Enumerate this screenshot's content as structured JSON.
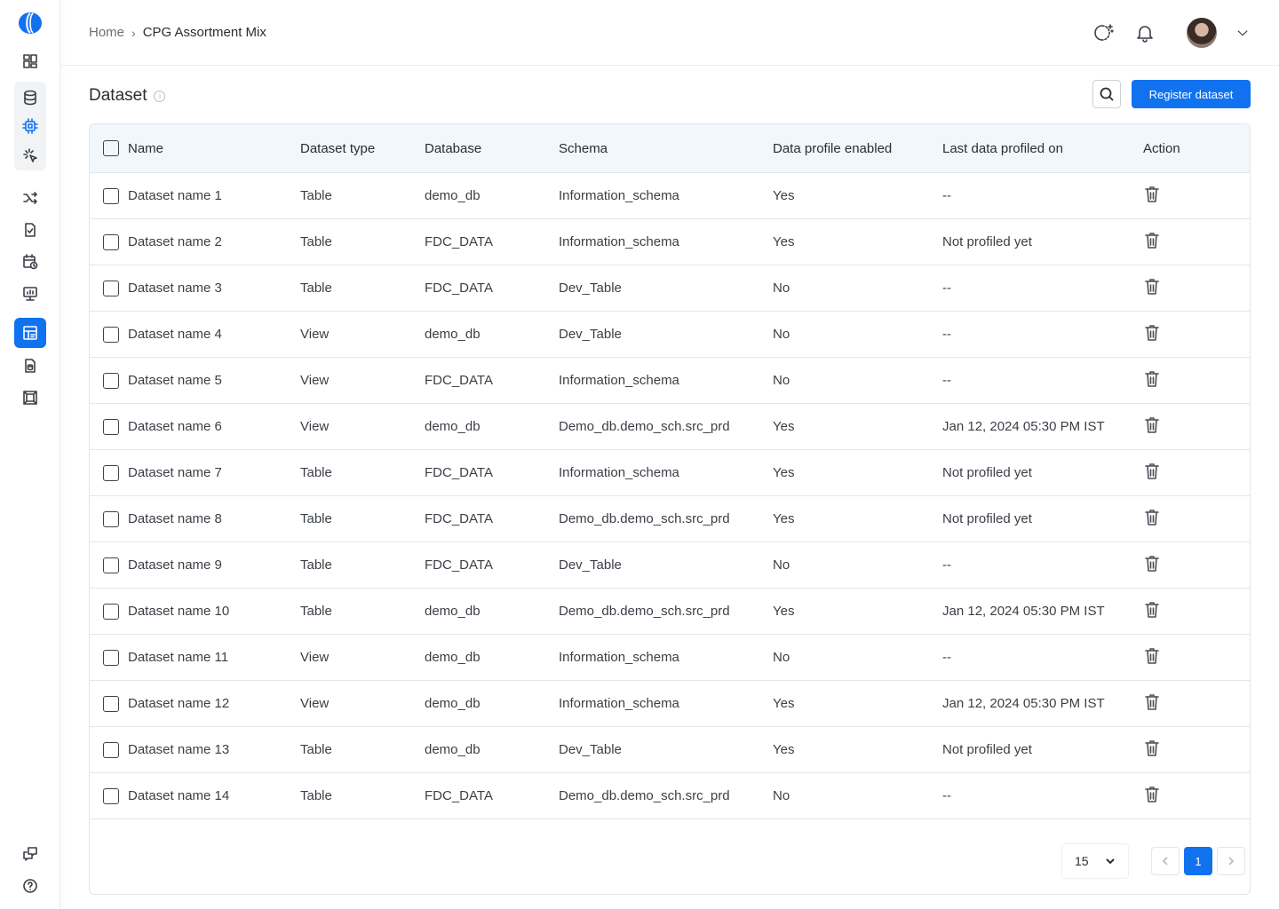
{
  "breadcrumb": {
    "home": "Home",
    "current": "CPG Assortment Mix"
  },
  "page": {
    "title": "Dataset",
    "info_glyph": "i"
  },
  "actions": {
    "register_label": "Register dataset"
  },
  "table": {
    "headers": {
      "name": "Name",
      "type": "Dataset type",
      "database": "Database",
      "schema": "Schema",
      "profile": "Data profile enabled",
      "last": "Last data profiled on",
      "action": "Action"
    },
    "rows": [
      {
        "name": "Dataset name 1",
        "type": "Table",
        "database": "demo_db",
        "schema": "Information_schema",
        "profile": "Yes",
        "last": "--"
      },
      {
        "name": "Dataset name 2",
        "type": "Table",
        "database": "FDC_DATA",
        "schema": "Information_schema",
        "profile": "Yes",
        "last": "Not profiled yet"
      },
      {
        "name": "Dataset name 3",
        "type": "Table",
        "database": "FDC_DATA",
        "schema": "Dev_Table",
        "profile": "No",
        "last": "--"
      },
      {
        "name": "Dataset name 4",
        "type": "View",
        "database": "demo_db",
        "schema": "Dev_Table",
        "profile": "No",
        "last": "--"
      },
      {
        "name": "Dataset name 5",
        "type": "View",
        "database": "FDC_DATA",
        "schema": "Information_schema",
        "profile": "No",
        "last": "--"
      },
      {
        "name": "Dataset name 6",
        "type": "View",
        "database": "demo_db",
        "schema": "Demo_db.demo_sch.src_prd",
        "profile": "Yes",
        "last": "Jan 12, 2024 05:30 PM IST"
      },
      {
        "name": "Dataset name 7",
        "type": "Table",
        "database": "FDC_DATA",
        "schema": "Information_schema",
        "profile": "Yes",
        "last": "Not profiled yet"
      },
      {
        "name": "Dataset name 8",
        "type": "Table",
        "database": "FDC_DATA",
        "schema": "Demo_db.demo_sch.src_prd",
        "profile": "Yes",
        "last": "Not profiled yet"
      },
      {
        "name": "Dataset name 9",
        "type": "Table",
        "database": "FDC_DATA",
        "schema": "Dev_Table",
        "profile": "No",
        "last": "--"
      },
      {
        "name": "Dataset name 10",
        "type": "Table",
        "database": "demo_db",
        "schema": "Demo_db.demo_sch.src_prd",
        "profile": "Yes",
        "last": "Jan 12, 2024 05:30 PM IST"
      },
      {
        "name": "Dataset name 11",
        "type": "View",
        "database": "demo_db",
        "schema": "Information_schema",
        "profile": "No",
        "last": "--"
      },
      {
        "name": "Dataset name 12",
        "type": "View",
        "database": "demo_db",
        "schema": "Information_schema",
        "profile": "Yes",
        "last": "Jan 12, 2024 05:30 PM IST"
      },
      {
        "name": "Dataset name 13",
        "type": "Table",
        "database": "demo_db",
        "schema": "Dev_Table",
        "profile": "Yes",
        "last": "Not profiled yet"
      },
      {
        "name": "Dataset name 14",
        "type": "Table",
        "database": "FDC_DATA",
        "schema": "Demo_db.demo_sch.src_prd",
        "profile": "No",
        "last": "--"
      }
    ]
  },
  "pagination": {
    "page_size": "15",
    "current_page": "1"
  },
  "colors": {
    "accent": "#1172f0",
    "header_bg": "#f2f7fd",
    "border": "#e3e6ea"
  },
  "icons": {
    "sidebar": [
      "dashboard-icon",
      "database-icon",
      "chip-icon",
      "sparkle-cursor-icon",
      "shuffle-icon",
      "file-check-icon",
      "calendar-clock-icon",
      "monitor-chart-icon",
      "dataset-table-icon",
      "document-db-icon",
      "frame-icon",
      "chat-icon",
      "help-icon"
    ],
    "header": [
      "theme-toggle-icon",
      "bell-icon",
      "avatar",
      "chevron-down-icon"
    ]
  }
}
